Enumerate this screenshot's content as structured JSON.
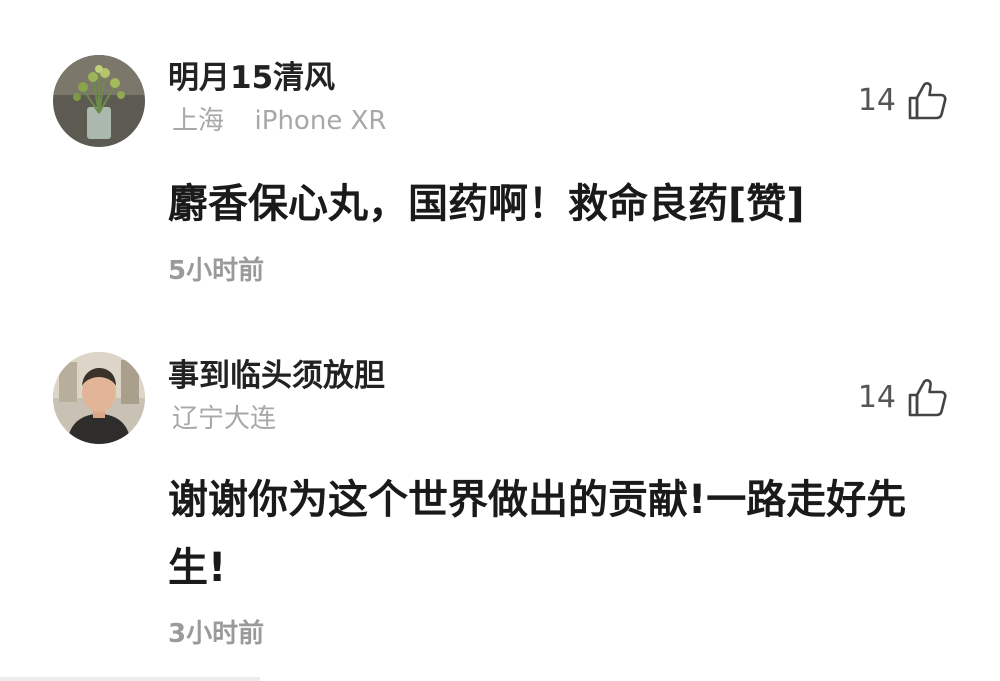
{
  "comments": [
    {
      "username": "明月15清风",
      "location": "上海",
      "device": "iPhone XR",
      "likes": "14",
      "text": "麝香保心丸，国药啊！救命良药[赞]",
      "time": "5小时前"
    },
    {
      "username": "事到临头须放胆",
      "location": "辽宁大连",
      "likes": "14",
      "text": "谢谢你为这个世界做出的贡献!一路走好先生!",
      "time": "3小时前"
    }
  ],
  "icons": {
    "like": "thumbs-up-icon"
  },
  "colors": {
    "username": "#222222",
    "meta": "#a8a8a8",
    "body": "#1a1a1a",
    "time": "#9a9a9a"
  }
}
